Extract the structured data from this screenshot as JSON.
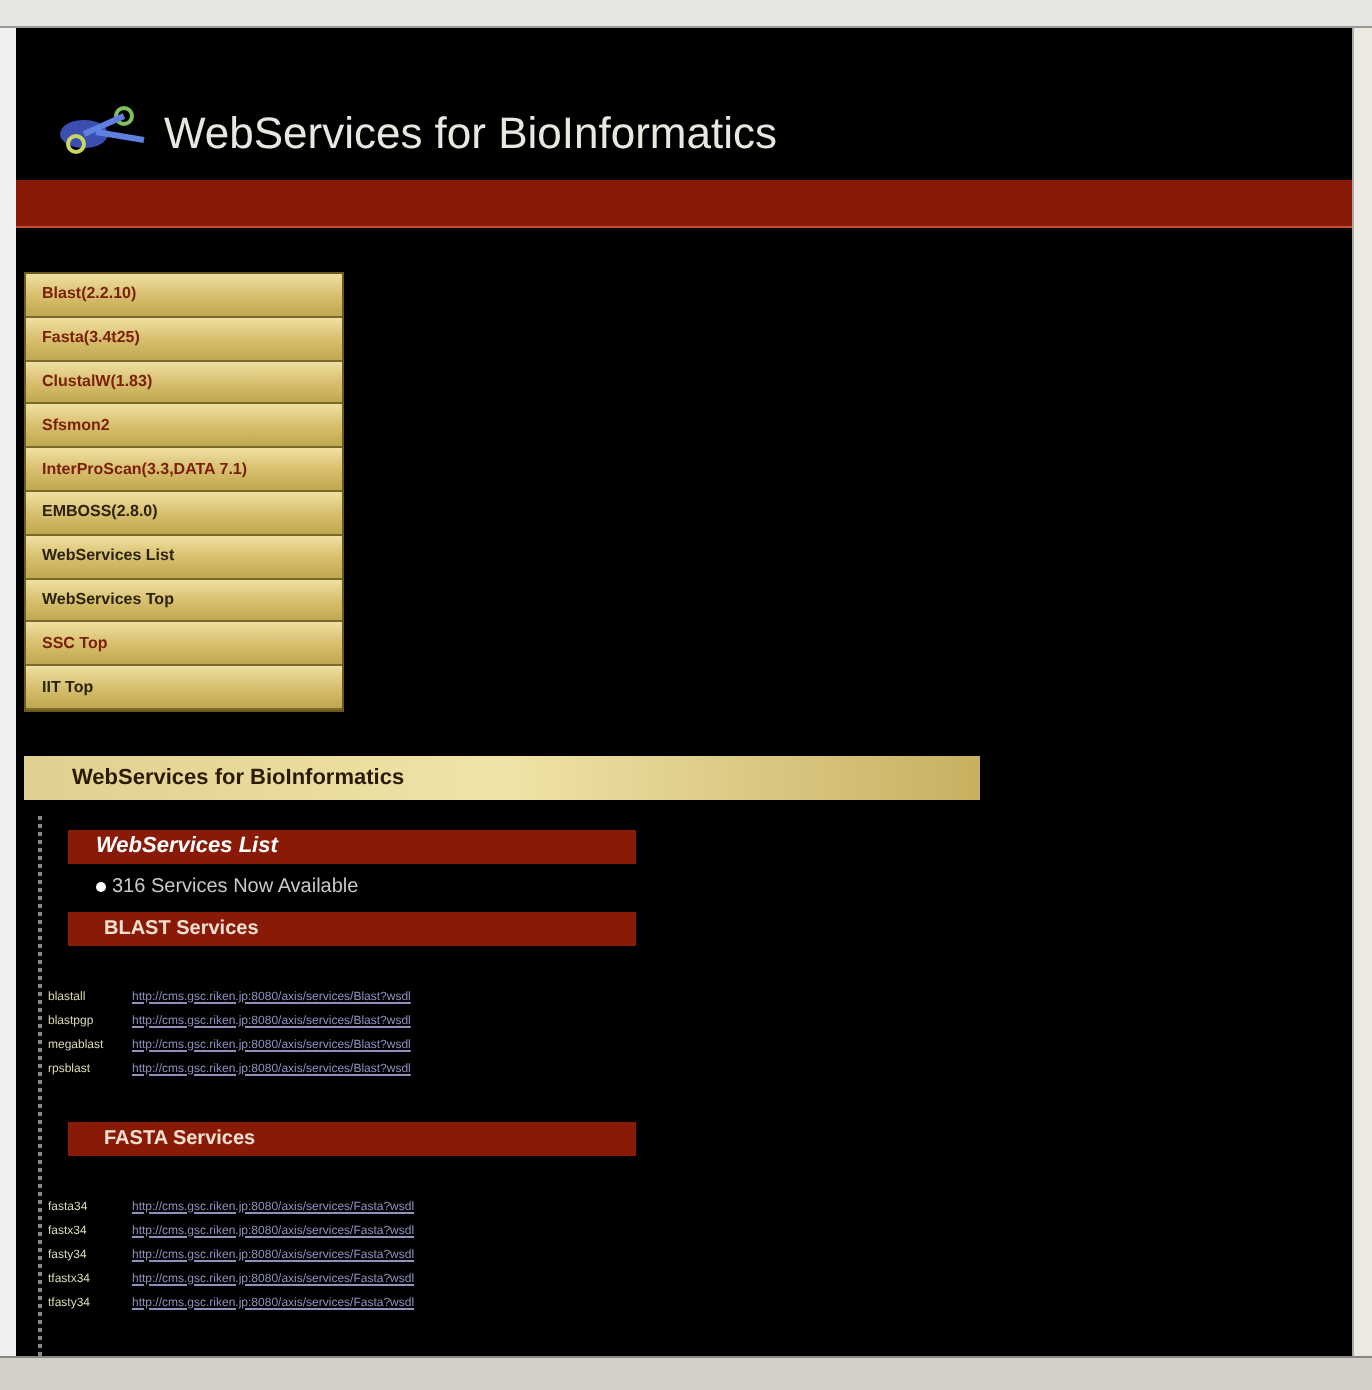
{
  "header": {
    "title": "WebServices for BioInformatics"
  },
  "menu": [
    {
      "label": "Blast(2.2.10)",
      "kind": "tool"
    },
    {
      "label": "Fasta(3.4t25)",
      "kind": "tool"
    },
    {
      "label": "ClustalW(1.83)",
      "kind": "tool"
    },
    {
      "label": "Sfsmon2",
      "kind": "tool"
    },
    {
      "label": "InterProScan(3.3,DATA 7.1)",
      "kind": "tool"
    },
    {
      "label": "EMBOSS(2.8.0)",
      "kind": "page"
    },
    {
      "label": "WebServices List",
      "kind": "page"
    },
    {
      "label": "WebServices Top",
      "kind": "page"
    },
    {
      "label": "SSC Top",
      "kind": "tool"
    },
    {
      "label": "IIT Top",
      "kind": "page"
    }
  ],
  "section_title": "WebServices for BioInformatics",
  "list_heading": "WebServices List",
  "available": "316 Services Now Available",
  "groups": [
    {
      "heading": "BLAST Services",
      "services": [
        {
          "name": "blastall",
          "url": "http://cms.gsc.riken.jp:8080/axis/services/Blast?wsdl"
        },
        {
          "name": "blastpgp",
          "url": "http://cms.gsc.riken.jp:8080/axis/services/Blast?wsdl"
        },
        {
          "name": "megablast",
          "url": "http://cms.gsc.riken.jp:8080/axis/services/Blast?wsdl"
        },
        {
          "name": "rpsblast",
          "url": "http://cms.gsc.riken.jp:8080/axis/services/Blast?wsdl"
        }
      ]
    },
    {
      "heading": "FASTA Services",
      "services": [
        {
          "name": "fasta34",
          "url": "http://cms.gsc.riken.jp:8080/axis/services/Fasta?wsdl"
        },
        {
          "name": "fastx34",
          "url": "http://cms.gsc.riken.jp:8080/axis/services/Fasta?wsdl"
        },
        {
          "name": "fasty34",
          "url": "http://cms.gsc.riken.jp:8080/axis/services/Fasta?wsdl"
        },
        {
          "name": "tfastx34",
          "url": "http://cms.gsc.riken.jp:8080/axis/services/Fasta?wsdl"
        },
        {
          "name": "tfasty34",
          "url": "http://cms.gsc.riken.jp:8080/axis/services/Fasta?wsdl"
        }
      ]
    }
  ]
}
